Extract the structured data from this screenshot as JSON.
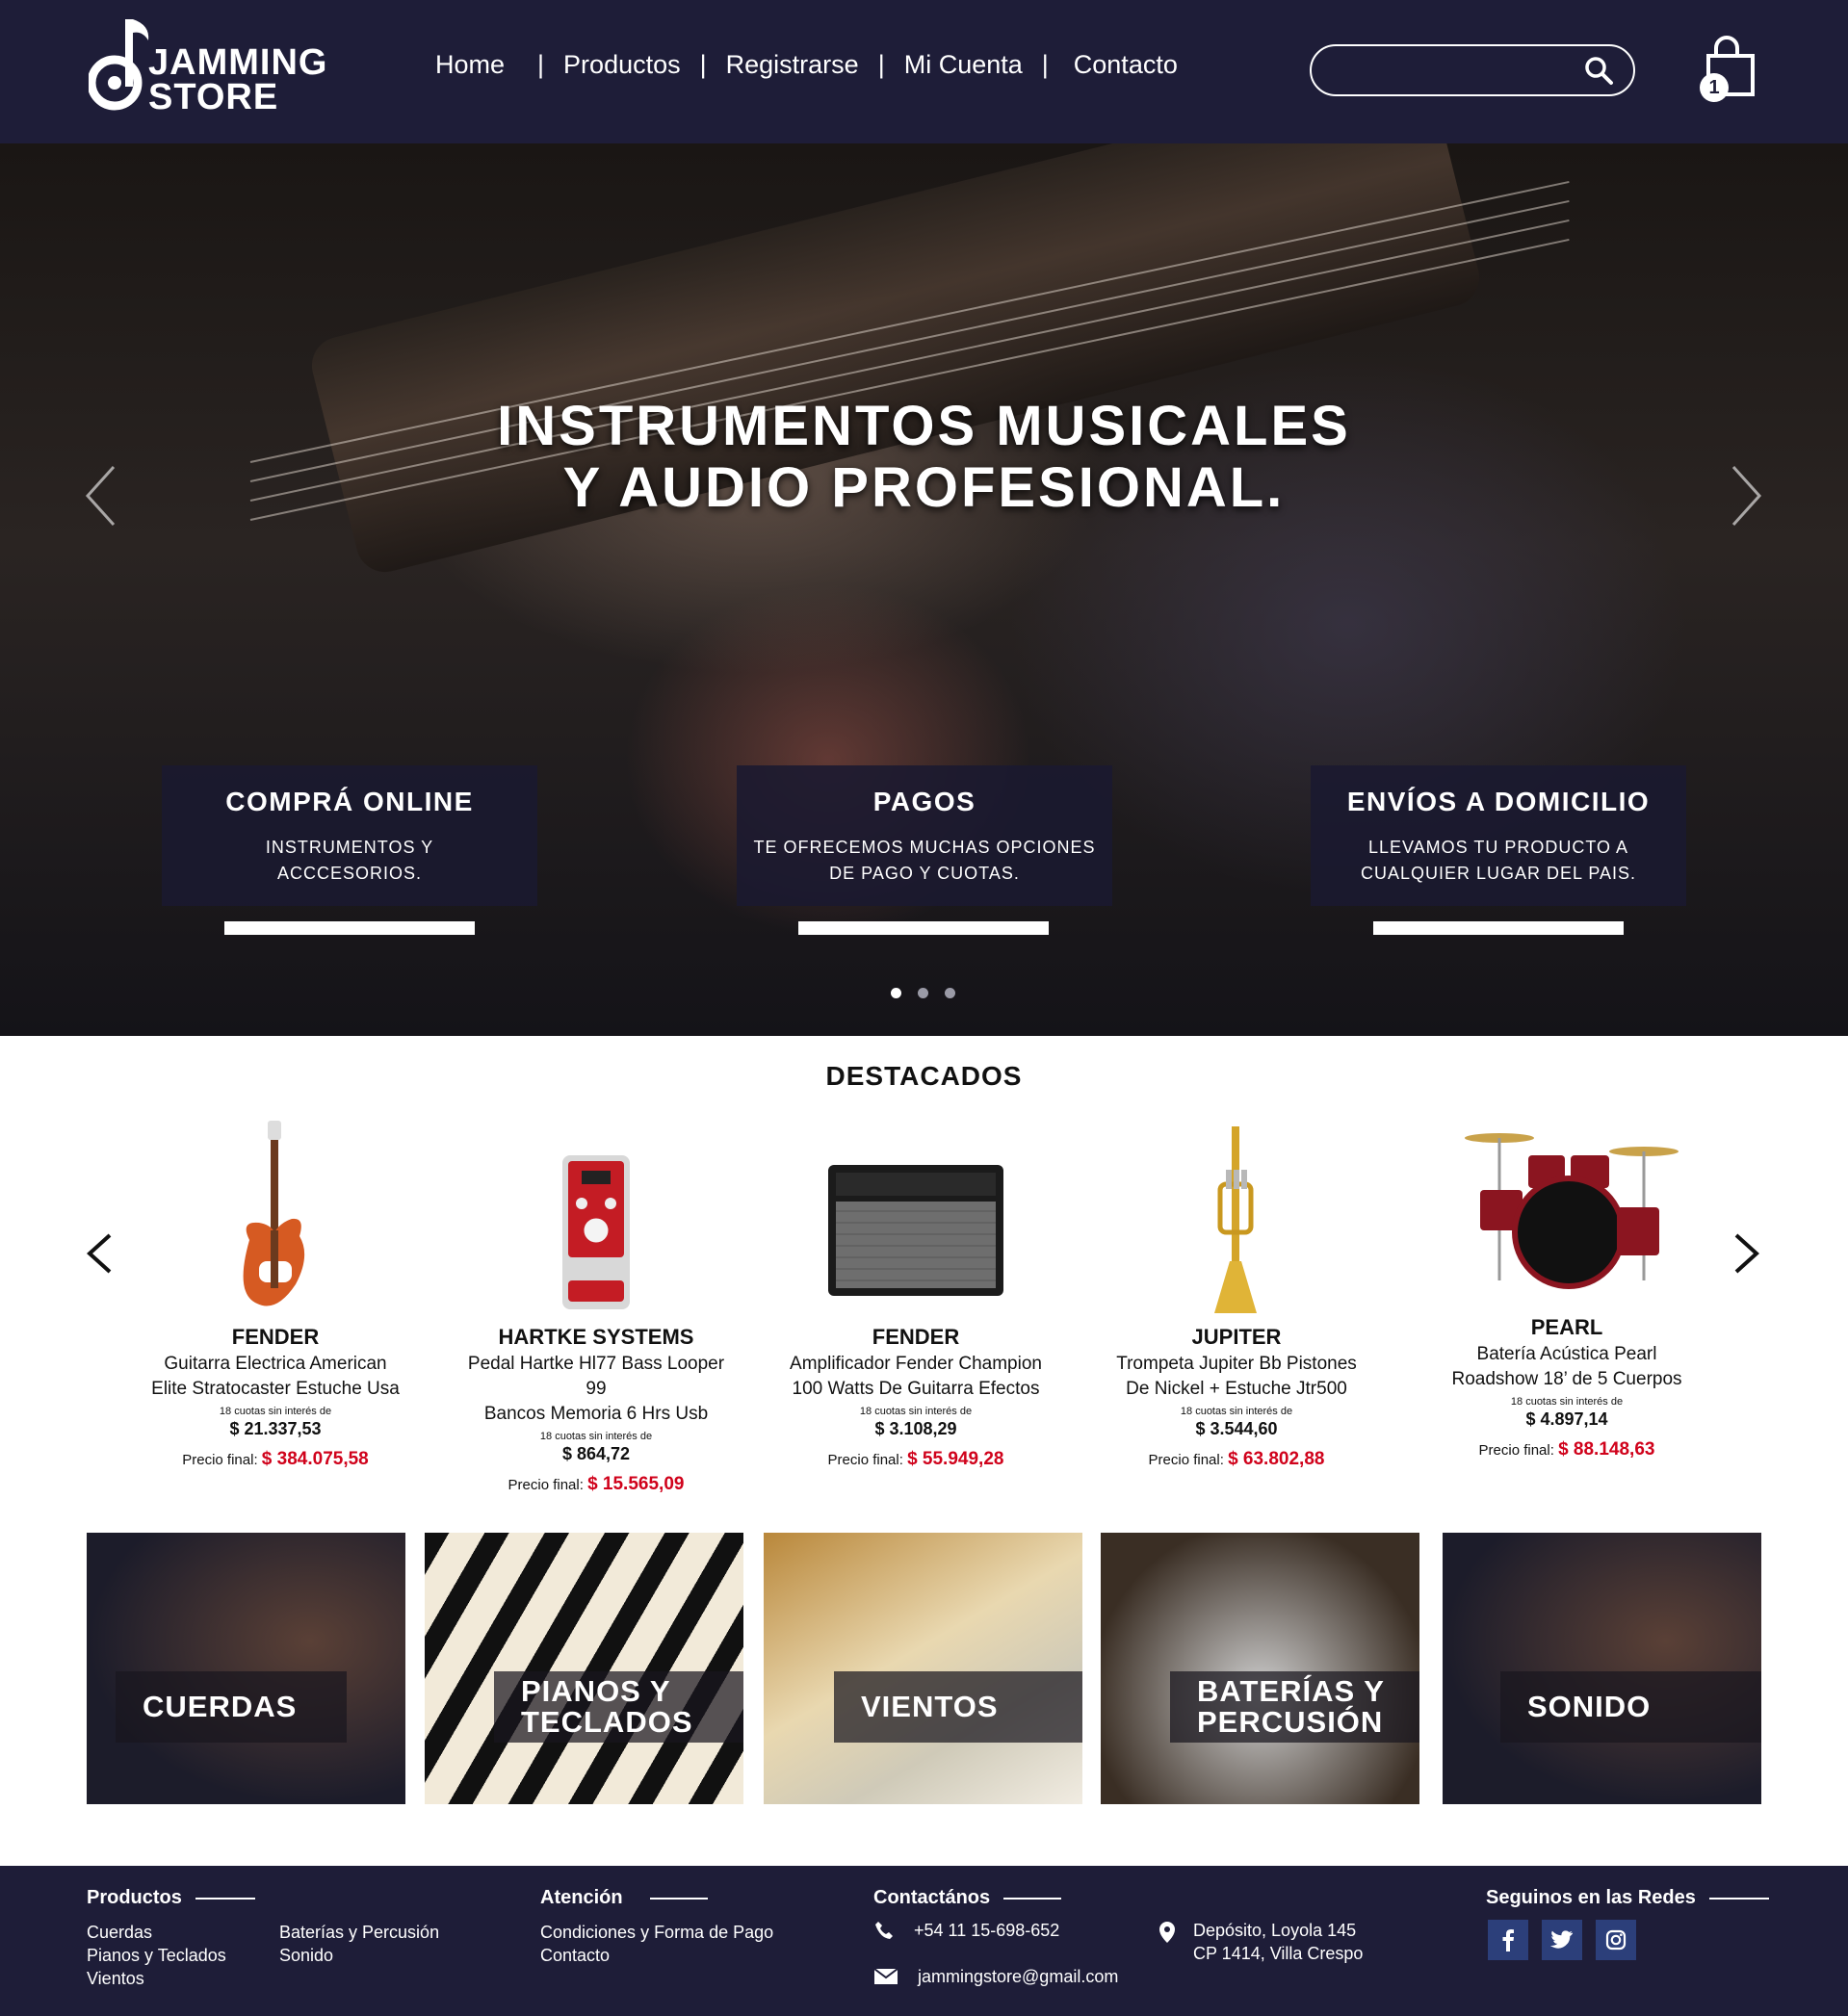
{
  "header": {
    "logo_line1": "JAMMING",
    "logo_line2": "STORE",
    "nav": [
      "Home",
      "Productos",
      "Registrarse",
      "Mi Cuenta",
      "Contacto"
    ],
    "search_placeholder": "",
    "cart_count": "1"
  },
  "hero": {
    "title_line1": "INSTRUMENTOS MUSICALES",
    "title_line2": "Y AUDIO PROFESIONAL.",
    "boxes": [
      {
        "title": "COMPRÁ ONLINE",
        "line1": "INSTRUMENTOS Y",
        "line2": "ACCCESORIOS."
      },
      {
        "title": "PAGOS",
        "line1": "TE OFRECEMOS MUCHAS OPCIONES",
        "line2": "DE PAGO Y CUOTAS."
      },
      {
        "title": "ENVÍOS A DOMICILIO",
        "line1": "LLEVAMOS TU PRODUCTO A",
        "line2": "CUALQUIER LUGAR DEL PAIS."
      }
    ],
    "slides_total": 3,
    "active_slide": 1
  },
  "featured": {
    "title": "DESTACADOS",
    "cuotas_label": "18 cuotas sin interés de",
    "final_label": "Precio final:",
    "products": [
      {
        "brand": "FENDER",
        "line1": "Guitarra Electrica American",
        "line2": "Elite Stratocaster Estuche Usa",
        "cuota": "$ 21.337,53",
        "final": "$ 384.075,58",
        "icon": "guitar-icon"
      },
      {
        "brand": "HARTKE SYSTEMS",
        "line1": "Pedal Hartke Hl77 Bass Looper 99",
        "line2": "Bancos Memoria 6 Hrs Usb",
        "cuota": "$ 864,72",
        "final": "$ 15.565,09",
        "icon": "pedal-icon"
      },
      {
        "brand": "FENDER",
        "line1": "Amplificador Fender Champion",
        "line2": "100 Watts De Guitarra Efectos",
        "cuota": "$ 3.108,29",
        "final": "$ 55.949,28",
        "icon": "amplifier-icon"
      },
      {
        "brand": "JUPITER",
        "line1": "Trompeta Jupiter Bb Pistones",
        "line2": "De Nickel + Estuche Jtr500",
        "cuota": "$ 3.544,60",
        "final": "$ 63.802,88",
        "icon": "trumpet-icon"
      },
      {
        "brand": "PEARL",
        "line1": "Batería Acústica Pearl",
        "line2": "Roadshow 18’ de 5 Cuerpos",
        "cuota": "$ 4.897,14",
        "final": "$ 88.148,63",
        "icon": "drum-kit-icon"
      }
    ]
  },
  "categories": [
    {
      "line1": "CUERDAS",
      "line2": ""
    },
    {
      "line1": "PIANOS Y",
      "line2": "TECLADOS"
    },
    {
      "line1": "VIENTOS",
      "line2": ""
    },
    {
      "line1": "BATERÍAS Y",
      "line2": "PERCUSIÓN"
    },
    {
      "line1": "SONIDO",
      "line2": ""
    }
  ],
  "footer": {
    "productos_title": "Productos",
    "productos_col1": [
      "Cuerdas",
      "Pianos y Teclados",
      "Vientos"
    ],
    "productos_col2": [
      "Baterías y Percusión",
      "Sonido"
    ],
    "atencion_title": "Atención",
    "atencion_items": [
      "Condiciones y Forma de Pago",
      "Contacto"
    ],
    "contacto_title": "Contactános",
    "phone": "+54 11 15-698-652",
    "email": "jammingstore@gmail.com",
    "address_line1": "Depósito, Loyola 145",
    "address_line2": "CP 1414, Villa Crespo",
    "redes_title": "Seguinos en las Redes",
    "social": [
      "facebook-icon",
      "twitter-icon",
      "instagram-icon"
    ]
  },
  "colors": {
    "navy": "#1e1d38",
    "price_red": "#d0021b",
    "social_blue": "#2c3f7a"
  }
}
